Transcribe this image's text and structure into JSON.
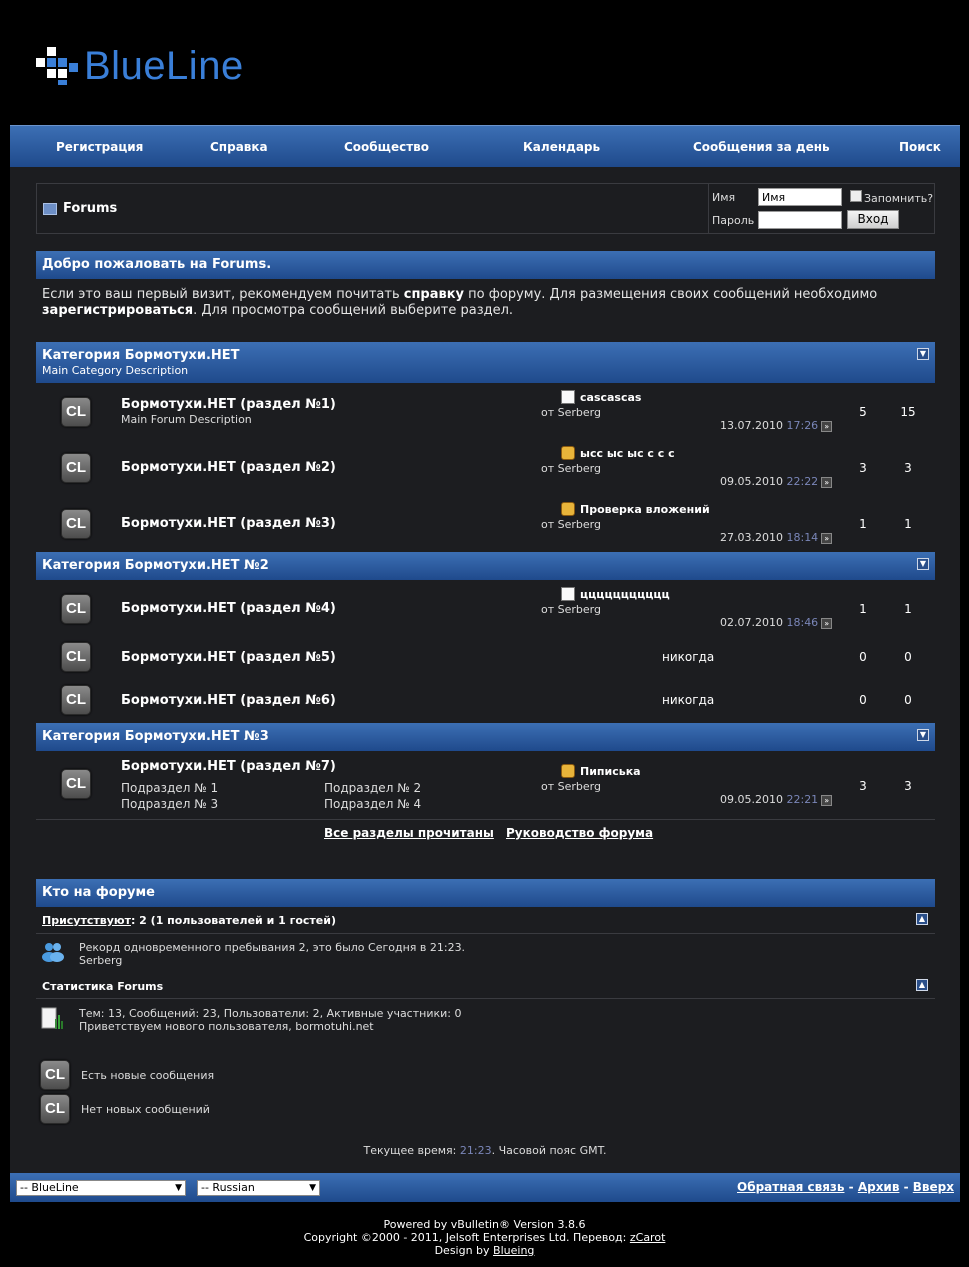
{
  "logo": {
    "text": "BlueLine"
  },
  "nav": {
    "items": [
      "Регистрация",
      "Справка",
      "Сообщество",
      "Календарь",
      "Сообщения за день",
      "Поиск"
    ]
  },
  "breadcrumb": {
    "title": "Forums"
  },
  "login": {
    "username_label": "Имя",
    "username_value": "Имя",
    "password_label": "Пароль",
    "remember_label": "Запомнить?",
    "submit_label": "Вход"
  },
  "welcome": {
    "title": "Добро пожаловать на Forums.",
    "text1": "Если это ваш первый визит, рекомендуем почитать ",
    "link_help": "справку",
    "text2": " по форуму. Для размещения своих сообщений необходимо ",
    "link_register": "зарегистрироваться",
    "text3": ". Для просмотра сообщений выберите раздел."
  },
  "categories": [
    {
      "title": "Категория Бормотухи.НЕТ",
      "description": "Main Category Description",
      "forums": [
        {
          "icon": "CL",
          "name": "Бормотухи.НЕТ (раздел №1)",
          "desc": "Main Forum Description",
          "post_title": "cascascas",
          "post_icon": "document",
          "by": "от Serberg",
          "date": "13.07.2010",
          "time": "17:26",
          "threads": "5",
          "posts": "15"
        },
        {
          "icon": "CL",
          "name": "Бормотухи.НЕТ (раздел №2)",
          "desc": "",
          "post_title": "ысс ыс ыс с с с",
          "post_icon": "thumbs-up",
          "by": "от Serberg",
          "date": "09.05.2010",
          "time": "22:22",
          "threads": "3",
          "posts": "3"
        },
        {
          "icon": "CL",
          "name": "Бормотухи.НЕТ (раздел №3)",
          "desc": "",
          "post_title": "Проверка вложений",
          "post_icon": "thumbs-up",
          "by": "от Serberg",
          "date": "27.03.2010",
          "time": "18:14",
          "threads": "1",
          "posts": "1"
        }
      ]
    },
    {
      "title": "Категория Бормотухи.НЕТ №2",
      "forums": [
        {
          "icon": "CL",
          "name": "Бормотухи.НЕТ (раздел №4)",
          "post_title": "ццццццццццц",
          "post_icon": "document",
          "by": "от Serberg",
          "date": "02.07.2010",
          "time": "18:46",
          "threads": "1",
          "posts": "1"
        },
        {
          "icon": "CL",
          "name": "Бормотухи.НЕТ (раздел №5)",
          "never": "никогда",
          "threads": "0",
          "posts": "0"
        },
        {
          "icon": "CL",
          "name": "Бормотухи.НЕТ (раздел №6)",
          "never": "никогда",
          "threads": "0",
          "posts": "0"
        }
      ]
    },
    {
      "title": "Категория Бормотухи.НЕТ №3",
      "forums": [
        {
          "icon": "CL",
          "name": "Бормотухи.НЕТ (раздел №7)",
          "subforums": [
            "Подраздел № 1",
            "Подраздел № 2",
            "Подраздел № 3",
            "Подраздел № 4"
          ],
          "post_title": "Пиписька",
          "post_icon": "thumbs-up",
          "by": "от Serberg",
          "date": "09.05.2010",
          "time": "22:21",
          "threads": "3",
          "posts": "3"
        }
      ]
    }
  ],
  "bottom_links": {
    "mark_read": "Все разделы прочитаны",
    "guide": "Руководство форума"
  },
  "online": {
    "title": "Кто на форуме",
    "present_link": "Присутствуют",
    "present_rest": ": 2 (1 пользователей и 1 гостей)",
    "record": "Рекорд одновременного пребывания 2, это было Сегодня в 21:23.",
    "users": "Serberg",
    "stats_title": "Статистика Forums",
    "stats": "Тем: 13, Сообщений: 23, Пользователи: 2, Активные участники: 0",
    "welcome_user": "Приветствуем нового пользователя, bormotuhi.net"
  },
  "legend": {
    "new": "Есть новые сообщения",
    "old": "Нет новых сообщений",
    "icon": "CL"
  },
  "time": {
    "prefix": "Текущее время: ",
    "value": "21:23",
    "suffix": ". Часовой пояс GMT."
  },
  "footer": {
    "style_select": "-- BlueLine",
    "lang_select": "-- Russian",
    "links": [
      "Обратная связь",
      "Архив",
      "Вверх"
    ],
    "powered": "Powered by vBulletin® Version 3.8.6",
    "copyright": "Copyright ©2000 - 2011, Jelsoft Enterprises Ltd. Перевод: ",
    "translator": "zCarot",
    "design_prefix": "Design by ",
    "designer": "Blueing"
  },
  "colors": {
    "accent": "#3a7fd8",
    "bar_top": "#3c6fb4",
    "bar_bottom": "#1f4a8c",
    "background": "#1c1d20"
  }
}
